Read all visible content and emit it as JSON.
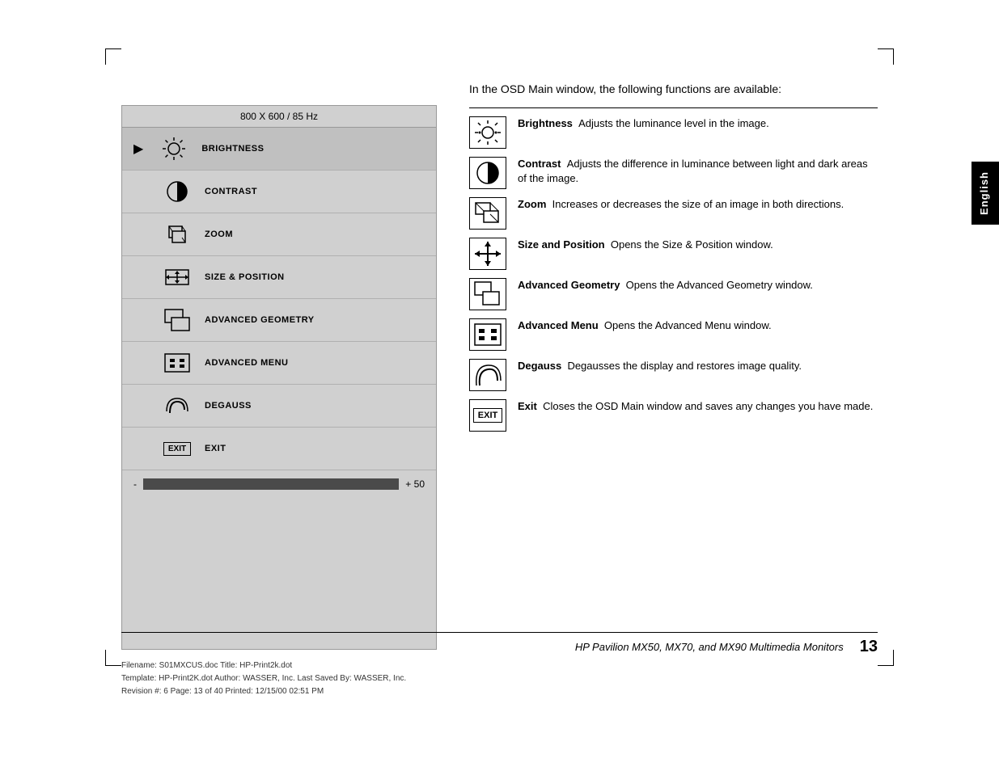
{
  "page": {
    "title": "HP Pavilion MX50, MX70, and MX90 Multimedia Monitors",
    "page_number": "13",
    "english_tab": "English"
  },
  "osd": {
    "header": "800 X 600 / 85 Hz",
    "items": [
      {
        "id": "brightness",
        "label": "BRIGHTNESS",
        "active": true
      },
      {
        "id": "contrast",
        "label": "CONTRAST",
        "active": false
      },
      {
        "id": "zoom",
        "label": "ZOOM",
        "active": false
      },
      {
        "id": "size-position",
        "label": "SIZE & POSITION",
        "active": false
      },
      {
        "id": "advanced-geometry",
        "label": "ADVANCED GEOMETRY",
        "active": false
      },
      {
        "id": "advanced-menu",
        "label": "ADVANCED MENU",
        "active": false
      },
      {
        "id": "degauss",
        "label": "DEGAUSS",
        "active": false
      },
      {
        "id": "exit",
        "label": "EXIT",
        "active": false
      }
    ],
    "slider": {
      "minus": "-",
      "plus": "+ 50"
    }
  },
  "intro": {
    "text": "In the OSD Main window, the following functions are available:"
  },
  "functions": [
    {
      "id": "brightness",
      "title": "Brightness",
      "description": "Adjusts the luminance level  in the image."
    },
    {
      "id": "contrast",
      "title": "Contrast",
      "description": "Adjusts the difference in luminance between light and dark areas of the image."
    },
    {
      "id": "zoom",
      "title": "Zoom",
      "description": "Increases or decreases the size of an image in both directions."
    },
    {
      "id": "size-and-position",
      "title": "Size and Position",
      "description": "Opens the Size & Position window."
    },
    {
      "id": "advanced-geometry",
      "title": "Advanced Geometry",
      "description": "Opens the Advanced Geometry window."
    },
    {
      "id": "advanced-menu",
      "title": "Advanced Menu",
      "description": "Opens the Advanced Menu window."
    },
    {
      "id": "degauss",
      "title": "Degauss",
      "description": "Degausses the display and restores image quality."
    },
    {
      "id": "exit",
      "title": "Exit",
      "description": "Closes the OSD Main window and saves any changes you have made."
    }
  ],
  "footer": {
    "title": "HP Pavilion MX50, MX70, and MX90 Multimedia Monitors",
    "page_number": "13",
    "meta_line1": "Filename: S01MXCUS.doc     Title: HP-Print2k.dot",
    "meta_line2": "Template: HP-Print2K.dot     Author: WASSER, Inc.     Last Saved By: WASSER, Inc.",
    "meta_line3": "Revision #: 6     Page: 13 of 40     Printed: 12/15/00 02:51 PM"
  }
}
